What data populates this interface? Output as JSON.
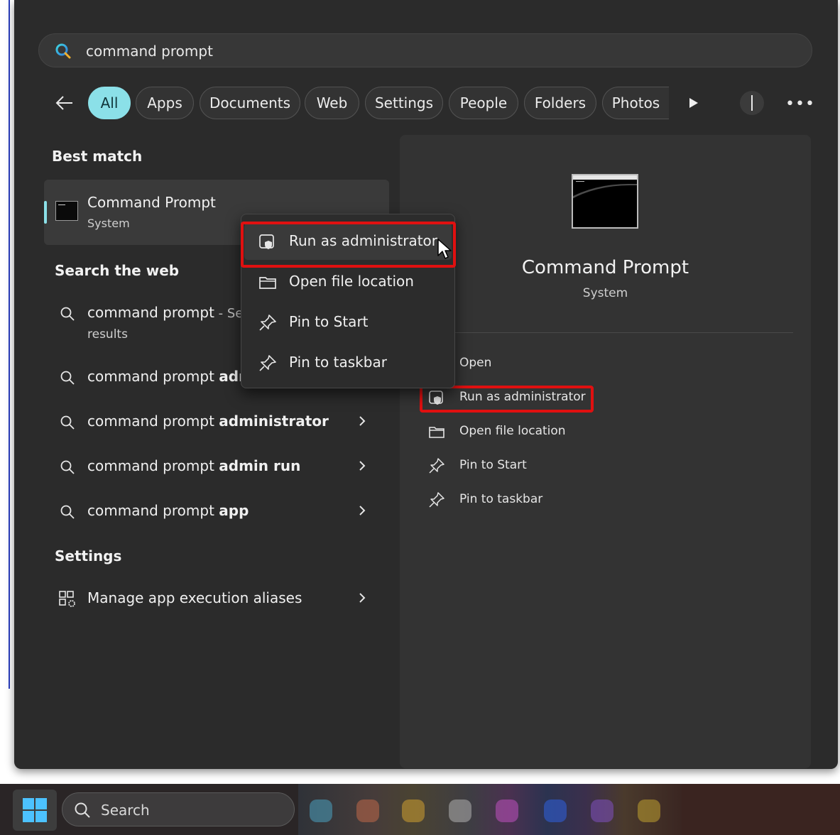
{
  "search": {
    "query": "command prompt"
  },
  "filters": {
    "chips": [
      "All",
      "Apps",
      "Documents",
      "Web",
      "Settings",
      "People",
      "Folders",
      "Photos"
    ],
    "active": "All"
  },
  "best_match": {
    "heading": "Best match",
    "title": "Command Prompt",
    "subtitle": "System"
  },
  "web": {
    "heading": "Search the web",
    "first": {
      "query": "command prompt",
      "suffix": " - See",
      "line2": "results"
    },
    "suggestions": [
      {
        "prefix": "command prompt ",
        "bold": "adm"
      },
      {
        "prefix": "command prompt ",
        "bold": "administrator"
      },
      {
        "prefix": "command prompt ",
        "bold": "admin run"
      },
      {
        "prefix": "command prompt ",
        "bold": "app"
      }
    ]
  },
  "settings": {
    "heading": "Settings",
    "item": "Manage app execution aliases"
  },
  "context_menu": {
    "items": [
      "Run as administrator",
      "Open file location",
      "Pin to Start",
      "Pin to taskbar"
    ]
  },
  "detail": {
    "title": "Command Prompt",
    "subtitle": "System",
    "actions": [
      "Open",
      "Run as administrator",
      "Open file location",
      "Pin to Start",
      "Pin to taskbar"
    ]
  },
  "taskbar": {
    "search_placeholder": "Search"
  },
  "colors": {
    "accent": "#8be0e8",
    "highlight": "#e01010",
    "panel": "#2b2b2b"
  }
}
